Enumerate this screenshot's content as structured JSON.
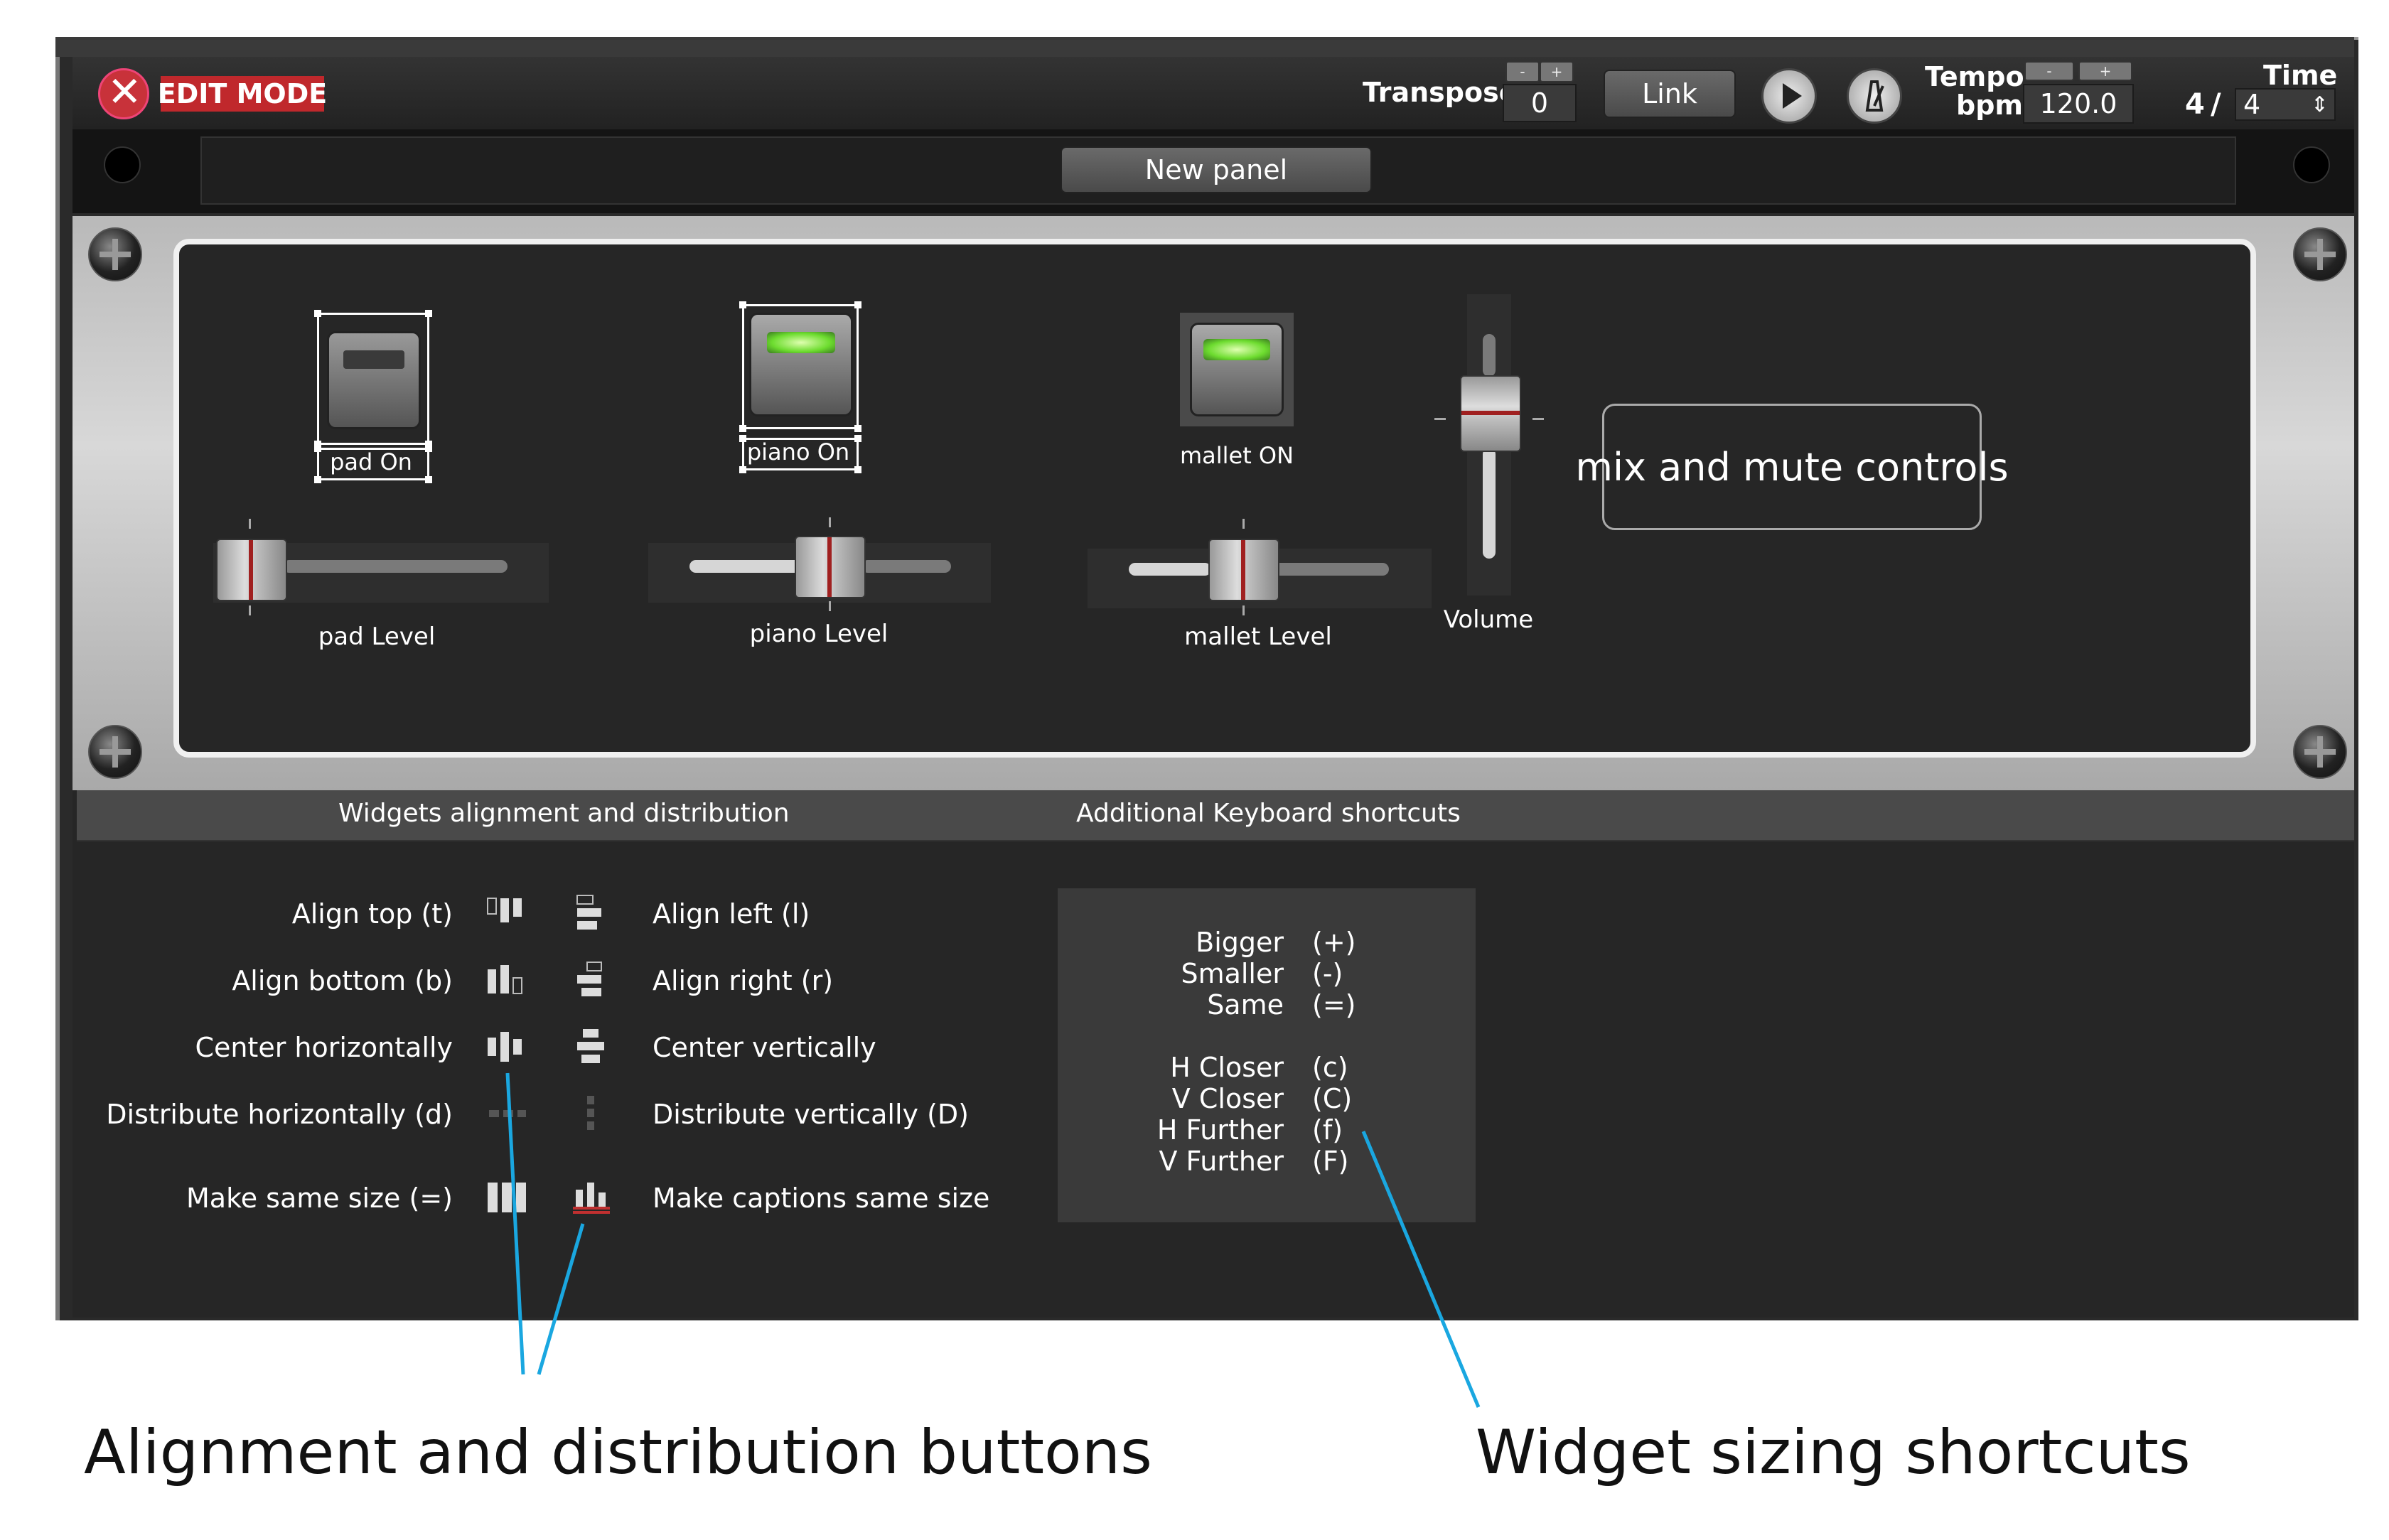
{
  "toolbar": {
    "edit_mode": "EDIT MODE",
    "transpose_label": "Transpose",
    "transpose_value": "0",
    "minus": "-",
    "plus": "+",
    "link_label": "Link",
    "tempo_label": "Tempo",
    "bpm_label": "bpm",
    "bpm_value": "120.0",
    "time_label": "Time",
    "time_num": "4",
    "time_sep": "/",
    "time_den": "4",
    "spin": "⇕"
  },
  "panel": {
    "title": "New panel",
    "widgets": {
      "pad_on": "pad On",
      "piano_on": "piano On",
      "mallet_on": "mallet ON",
      "pad_level": "pad Level",
      "piano_level": "piano Level",
      "mallet_level": "mallet Level",
      "volume": "Volume",
      "mix_label": "mix and mute controls"
    }
  },
  "tabs": {
    "alignment": "Widgets alignment and distribution",
    "shortcuts": "Additional Keyboard shortcuts"
  },
  "alignment": {
    "left": [
      "Align top (t)",
      "Align bottom (b)",
      "Center horizontally",
      "Distribute horizontally (d)",
      "Make same size (=)"
    ],
    "right": [
      "Align left (l)",
      "Align right (r)",
      "Center vertically",
      "Distribute vertically (D)",
      "Make captions same size"
    ]
  },
  "shortcuts": {
    "names": [
      "Bigger",
      "Smaller",
      "Same",
      "H Closer",
      "V Closer",
      "H Further",
      "V Further"
    ],
    "keys": [
      "(+)",
      "(-)",
      "(=)",
      "(c)",
      "(C)",
      "(f)",
      "(F)"
    ]
  },
  "annotations": {
    "left": "Alignment and distribution buttons",
    "right": "Widget sizing shortcuts",
    "color": "#1aa7e0"
  }
}
